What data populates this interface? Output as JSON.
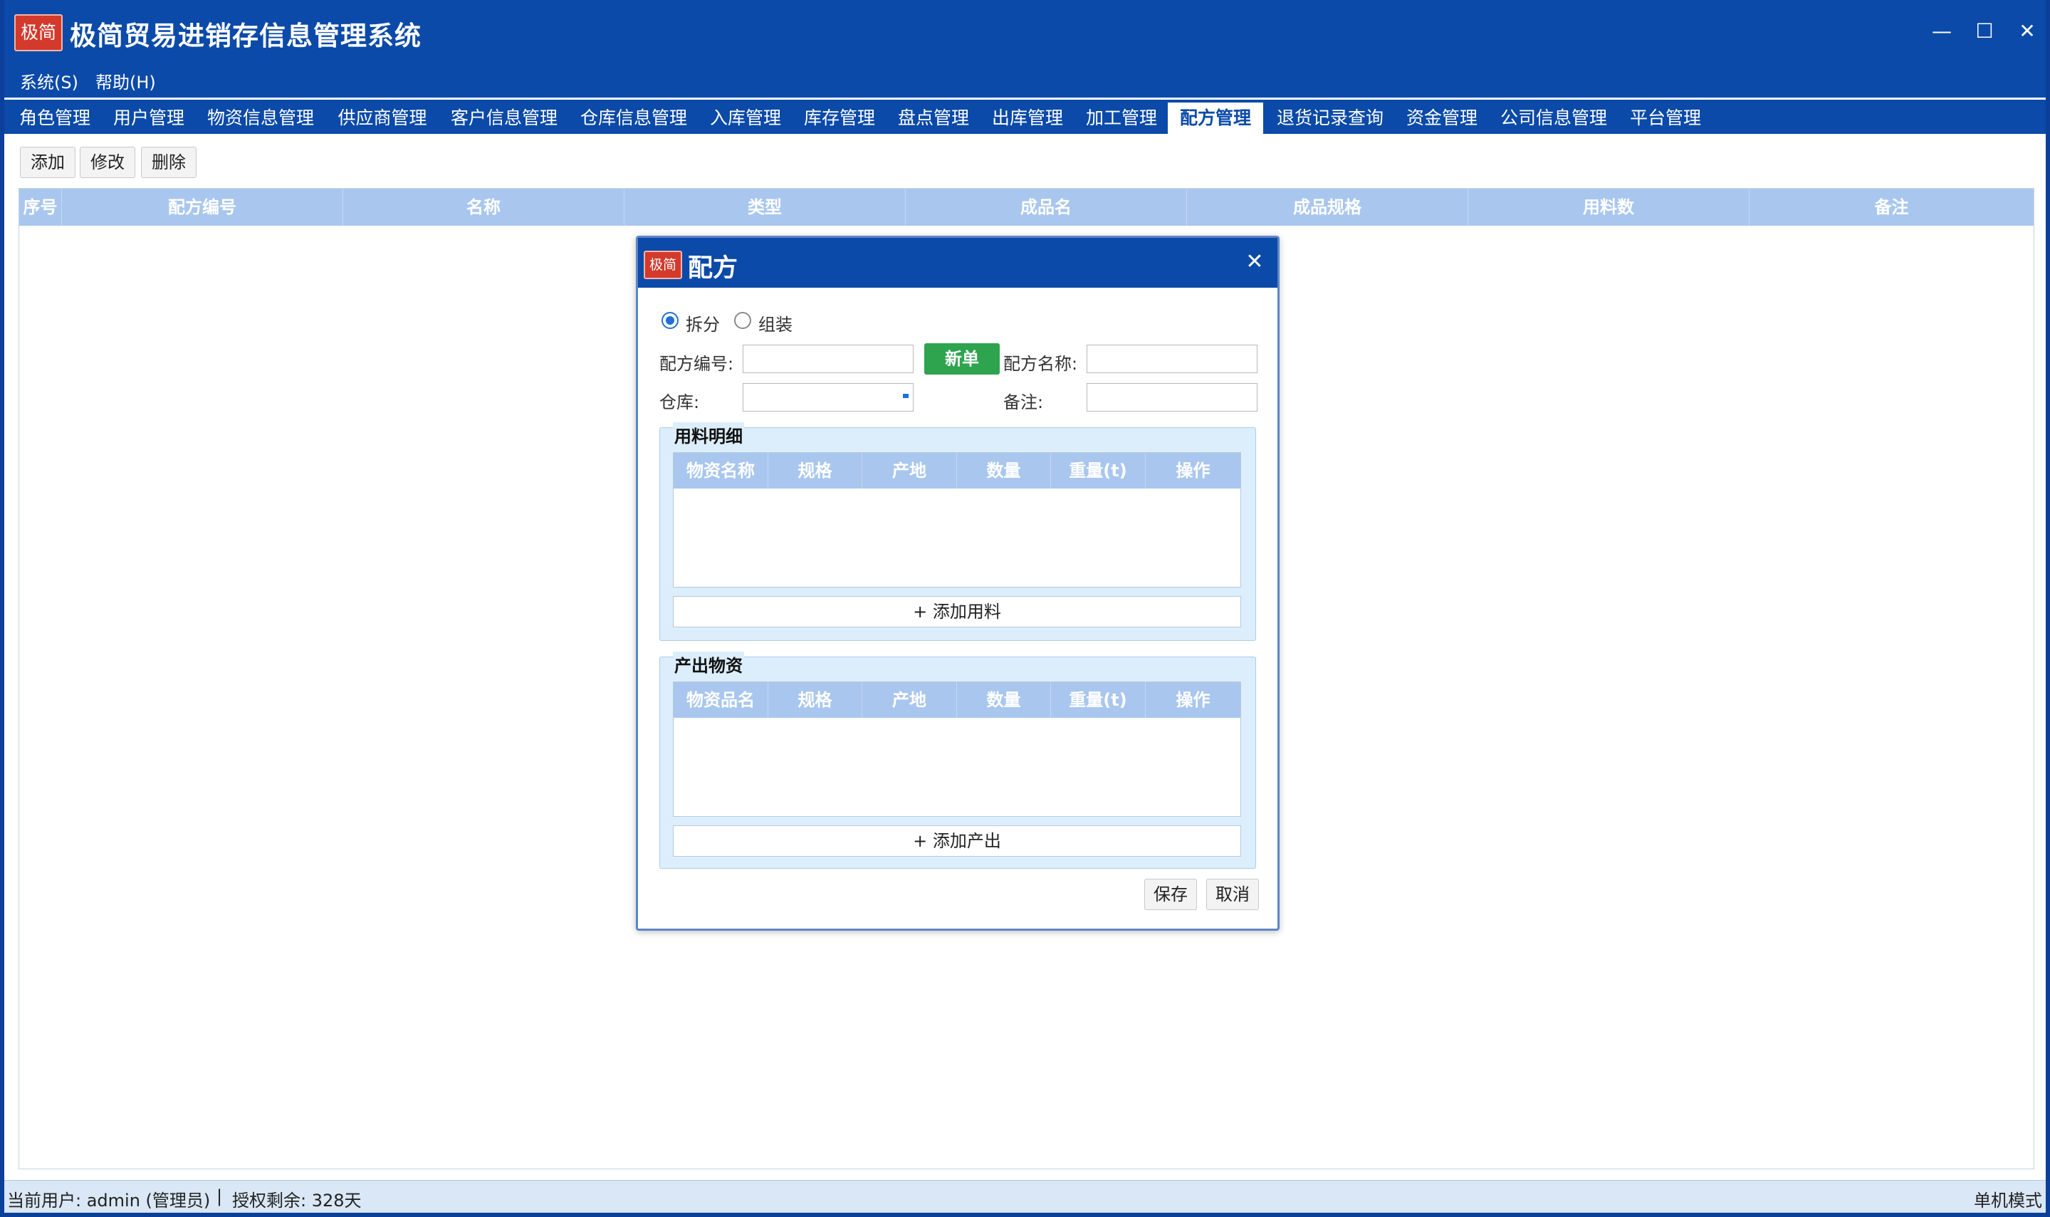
{
  "app": {
    "logo_text": "极简",
    "title": "极简贸易进销存信息管理系统",
    "controls": {
      "minimize": "—",
      "maximize": "☐",
      "close": "✕"
    }
  },
  "menu": {
    "items": [
      "系统(S)",
      "帮助(H)"
    ]
  },
  "tabs": {
    "items": [
      "角色管理",
      "用户管理",
      "物资信息管理",
      "供应商管理",
      "客户信息管理",
      "仓库信息管理",
      "入库管理",
      "库存管理",
      "盘点管理",
      "出库管理",
      "加工管理",
      "配方管理",
      "退货记录查询",
      "资金管理",
      "公司信息管理",
      "平台管理"
    ],
    "active": "配方管理"
  },
  "toolbar": {
    "add": "添加",
    "edit": "修改",
    "delete": "删除"
  },
  "grid": {
    "columns": [
      "序号",
      "配方编号",
      "名称",
      "类型",
      "成品名",
      "成品规格",
      "用料数",
      "备注"
    ]
  },
  "dialog": {
    "logo_text": "极简",
    "title": "配方",
    "close": "✕",
    "radio_split": "拆分",
    "radio_assemble": "组装",
    "selected_mode": "拆分",
    "recipe_no_label": "配方编号:",
    "recipe_no_value": "",
    "new_button": "新单",
    "recipe_name_label": "配方名称:",
    "recipe_name_value": "",
    "warehouse_label": "仓库:",
    "warehouse_value": "",
    "note_label": "备注:",
    "note_value": "",
    "materials": {
      "title": "用料明细",
      "columns": [
        "物资名称",
        "规格",
        "产地",
        "数量",
        "重量(t)",
        "操作"
      ],
      "add_button": "+ 添加用料"
    },
    "outputs": {
      "title": "产出物资",
      "columns": [
        "物资品名",
        "规格",
        "产地",
        "数量",
        "重量(t)",
        "操作"
      ],
      "add_button": "+ 添加产出"
    },
    "save": "保存",
    "cancel": "取消"
  },
  "status": {
    "current_user": "当前用户: admin (管理员)",
    "separator": "|",
    "license": "授权剩余: 328天",
    "mode": "单机模式"
  }
}
